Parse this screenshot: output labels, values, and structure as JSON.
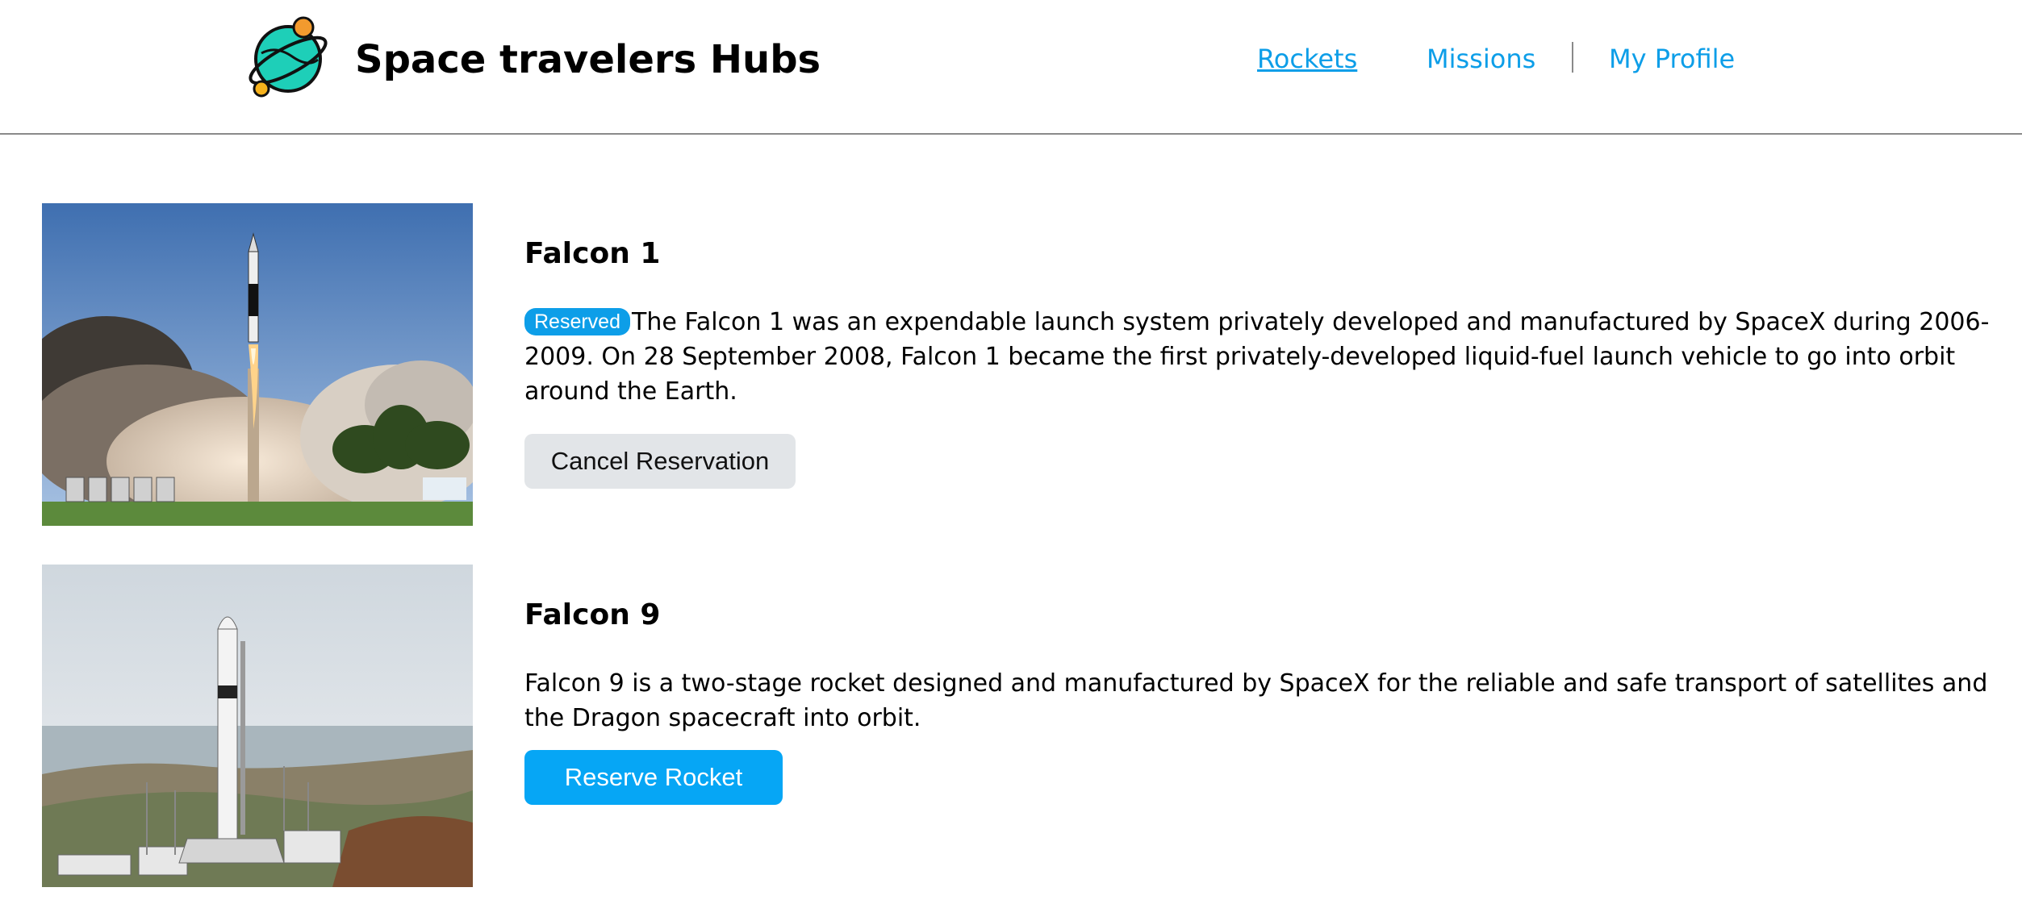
{
  "header": {
    "brand": "Space travelers Hubs",
    "logo_icon": "planet-icon",
    "nav": [
      {
        "label": "Rockets",
        "active": true
      },
      {
        "label": "Missions",
        "active": false
      },
      {
        "label": "My Profile",
        "active": false
      }
    ]
  },
  "colors": {
    "accent": "#0d9ee8",
    "reserve_button": "#06a6f5",
    "cancel_button": "#e2e5e8",
    "divider": "#8a8a8a"
  },
  "rockets": [
    {
      "name": "Falcon 1",
      "reserved": true,
      "badge": "Reserved",
      "description": "The Falcon 1 was an expendable launch system privately developed and manufactured by SpaceX during 2006-2009. On 28 September 2008, Falcon 1 became the first privately-developed liquid-fuel launch vehicle to go into orbit around the Earth.",
      "button_label": "Cancel Reservation",
      "image_icon": "rocket-launch-photo"
    },
    {
      "name": "Falcon 9",
      "reserved": false,
      "description": "Falcon 9 is a two-stage rocket designed and manufactured by SpaceX for the reliable and safe transport of satellites and the Dragon spacecraft into orbit.",
      "button_label": "Reserve Rocket",
      "image_icon": "rocket-pad-photo"
    }
  ]
}
